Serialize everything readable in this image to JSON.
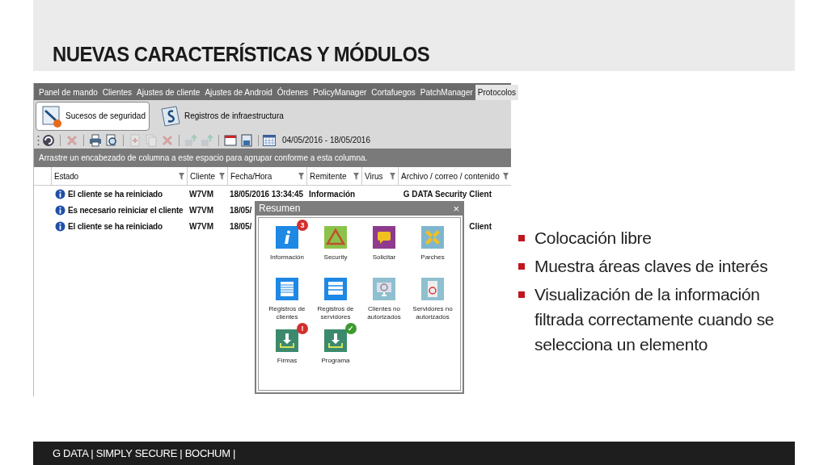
{
  "slide": {
    "title": "NUEVAS CARACTERÍSTICAS Y MÓDULOS",
    "bullets": [
      "Colocación libre",
      "Muestra áreas claves de interés",
      "Visualización de la información filtrada correctamente cuando se selecciona un elemento"
    ],
    "footer": "G DATA | SIMPLY SECURE | BOCHUM |"
  },
  "app": {
    "tabs": [
      {
        "label": "Panel de mando",
        "selected": false
      },
      {
        "label": "Clientes",
        "selected": false
      },
      {
        "label": "Ajustes de cliente",
        "selected": false
      },
      {
        "label": "Ajustes de Android",
        "selected": false
      },
      {
        "label": "Órdenes",
        "selected": false
      },
      {
        "label": "PolicyManager",
        "selected": false
      },
      {
        "label": "Cortafuegos",
        "selected": false
      },
      {
        "label": "PatchManager",
        "selected": false
      },
      {
        "label": "Protocolos",
        "selected": true
      }
    ],
    "ribbon": [
      {
        "label": "Sucesos de seguridad",
        "selected": true
      },
      {
        "label": "Registros de infraestructura",
        "selected": false
      }
    ],
    "toolbar": [
      {
        "disabled": false
      },
      {
        "disabled": true
      },
      {
        "disabled": false
      },
      {
        "disabled": false
      },
      {
        "disabled": true
      },
      {
        "disabled": true
      },
      {
        "disabled": true
      },
      {
        "disabled": true
      },
      {
        "disabled": true
      },
      {
        "disabled": false
      },
      {
        "disabled": false
      }
    ],
    "date_range": "04/05/2016 - 18/05/2016",
    "group_hint": "Arrastre un encabezado de columna a este espacio para agrupar conforme a esta columna.",
    "table": {
      "columns": [
        "Estado",
        "Cliente",
        "Fecha/Hora",
        "Remitente",
        "Virus",
        "Archivo / correo / contenido"
      ],
      "rows": [
        {
          "cells": [
            "El cliente se ha reiniciado",
            "W7VM",
            "18/05/2016 13:34:45",
            "Información",
            "",
            "G DATA Security Client"
          ]
        },
        {
          "cells": [
            "Es necesario reiniciar el cliente",
            "W7VM",
            "18/05/",
            "",
            "",
            ""
          ]
        },
        {
          "cells": [
            "El cliente se ha reiniciado",
            "W7VM",
            "18/05/",
            "",
            "",
            "Client"
          ]
        }
      ]
    },
    "summary": {
      "title": "Resumen",
      "close": "×",
      "tiles": [
        {
          "label": "Información",
          "badge": {
            "text": "3",
            "color": "#d32f2f"
          }
        },
        {
          "label": "Security"
        },
        {
          "label": "Solicitar"
        },
        {
          "label": "Parches"
        },
        {
          "label": "Registros de clientes"
        },
        {
          "label": "Registros de servidores"
        },
        {
          "label": "Clientes no autorizados"
        },
        {
          "label": "Servidores no autorizados"
        },
        {
          "label": "Firmas",
          "badge": {
            "text": "!",
            "color": "#d32f2f"
          }
        },
        {
          "label": "Programa",
          "badge": {
            "text": "✓",
            "color": "#3d9a2f"
          }
        }
      ]
    }
  }
}
